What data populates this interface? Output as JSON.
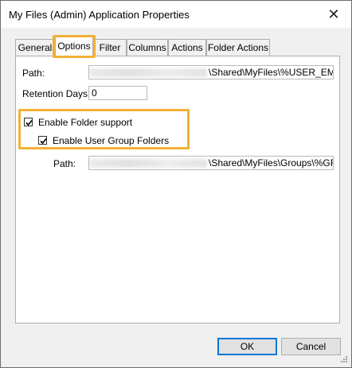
{
  "window": {
    "title": "My Files (Admin) Application Properties",
    "close_glyph": "✕"
  },
  "tabs": [
    {
      "label": "General"
    },
    {
      "label": "Options",
      "active": true
    },
    {
      "label": "Filter"
    },
    {
      "label": "Columns"
    },
    {
      "label": "Actions"
    },
    {
      "label": "Folder Actions"
    }
  ],
  "options": {
    "path_label": "Path:",
    "path_value": "\\Shared\\MyFiles\\%USER_EMAIL",
    "retention_label": "Retention Days:",
    "retention_value": "0",
    "enable_folder_support": {
      "label": "Enable Folder support",
      "checked": true
    },
    "enable_user_group_folders": {
      "label": "Enable User Group Folders",
      "checked": true
    },
    "group_path_label": "Path:",
    "group_path_value": "\\Shared\\MyFiles\\Groups\\%GROU"
  },
  "buttons": {
    "ok": "OK",
    "cancel": "Cancel"
  },
  "colors": {
    "highlight": "#f2b035",
    "accent": "#0078d7"
  }
}
